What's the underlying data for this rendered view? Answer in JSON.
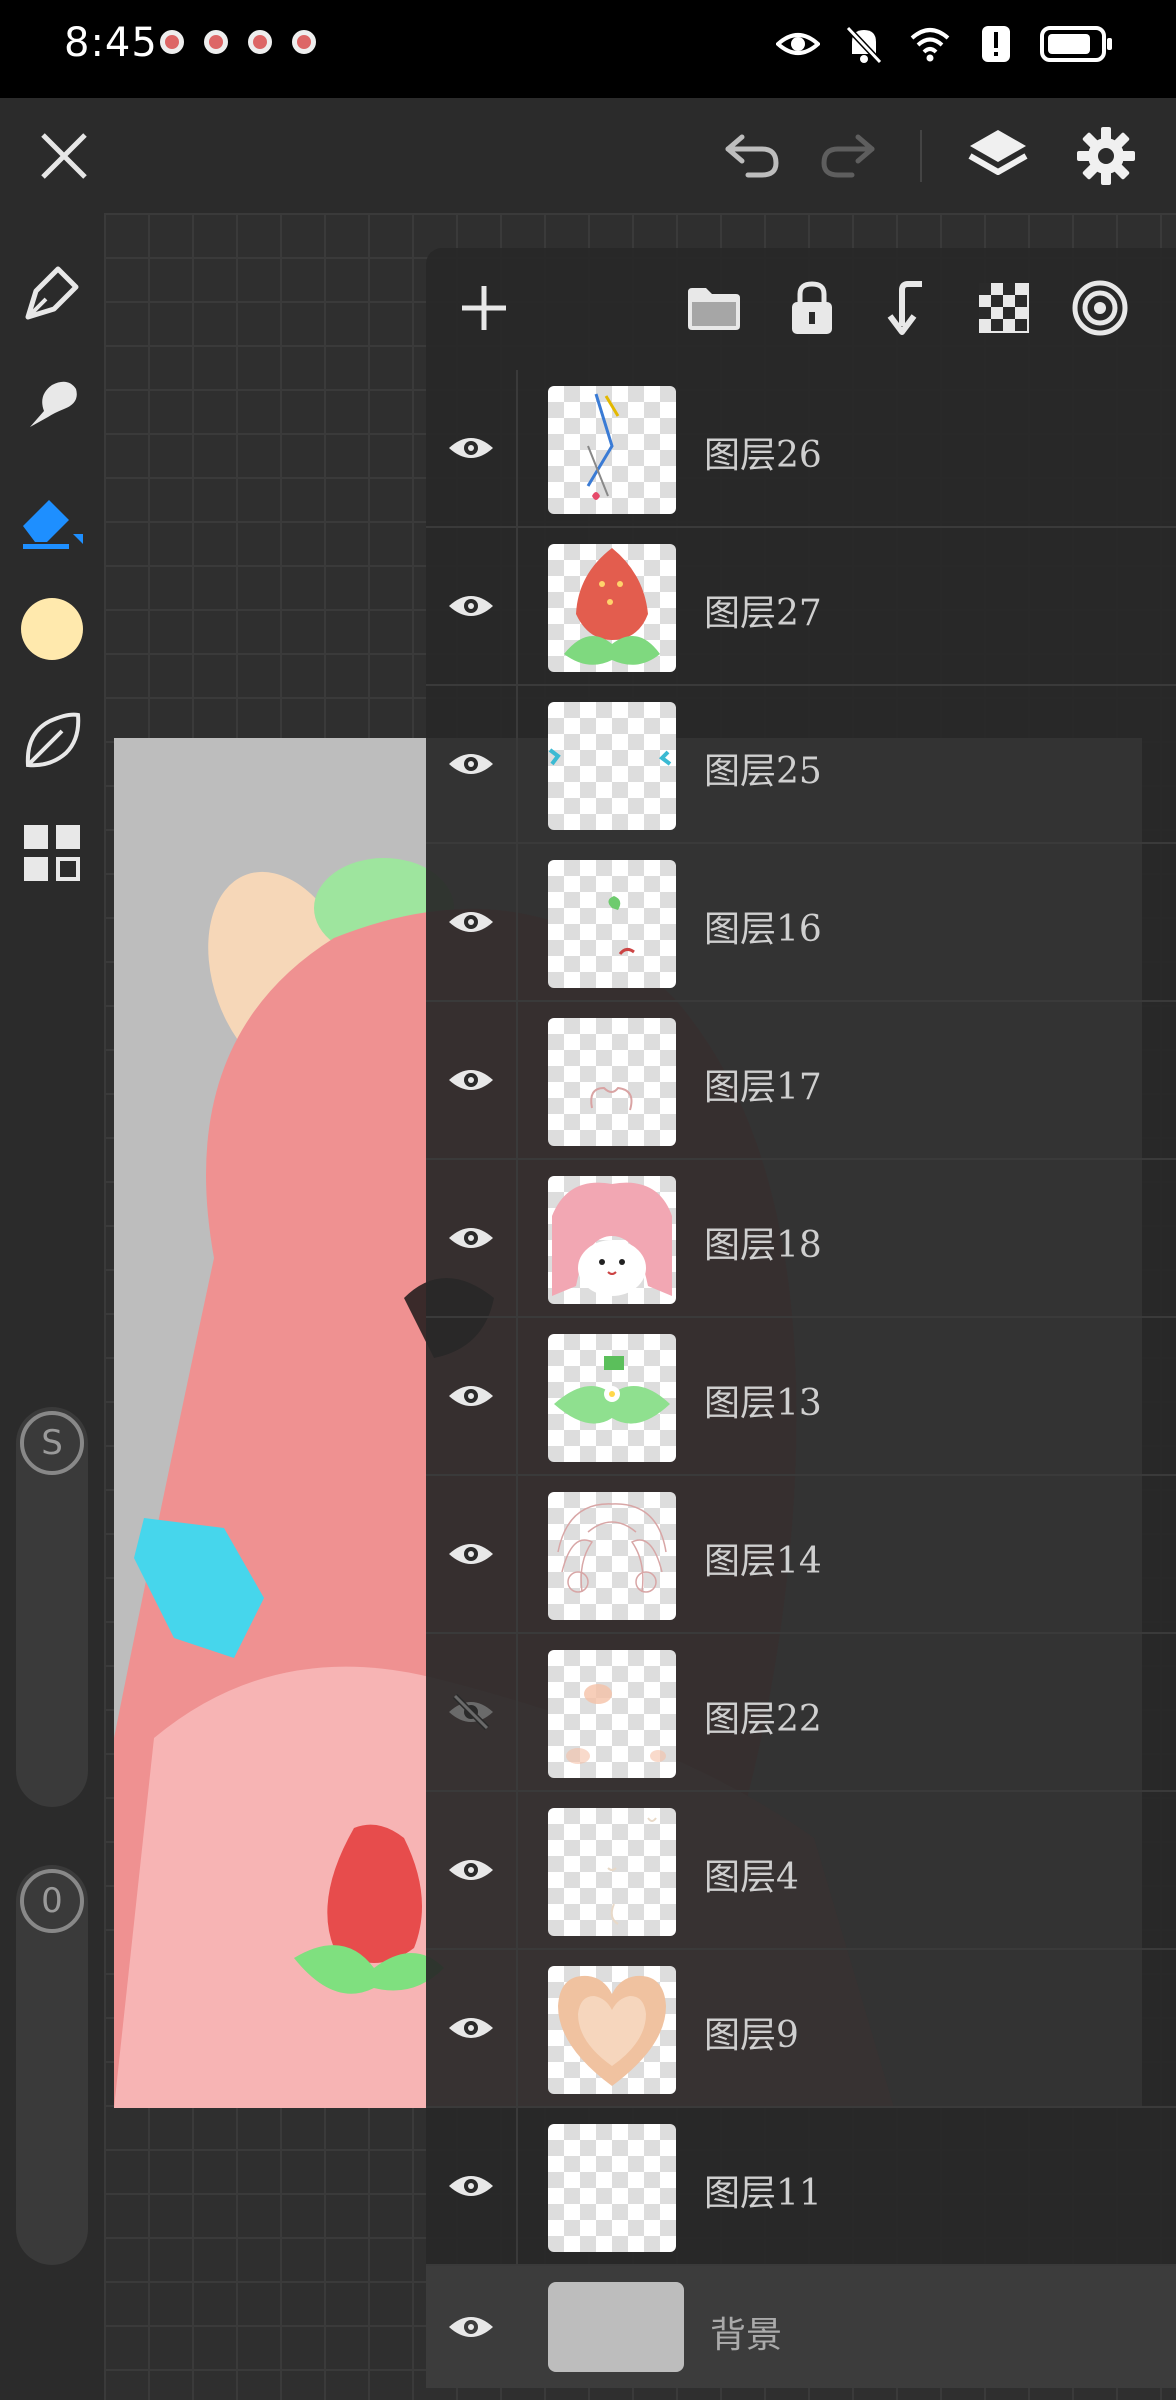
{
  "status_bar": {
    "time": "8:45"
  },
  "canvas": {
    "background_color": "#bdbdbd"
  },
  "layers": [
    {
      "name": "图层26",
      "visible": true,
      "thumb": "drop"
    },
    {
      "name": "图层27",
      "visible": true,
      "thumb": "strawberry"
    },
    {
      "name": "图层25",
      "visible": true,
      "thumb": "blue-edges"
    },
    {
      "name": "图层16",
      "visible": true,
      "thumb": "sprig"
    },
    {
      "name": "图层17",
      "visible": true,
      "thumb": "lines"
    },
    {
      "name": "图层18",
      "visible": true,
      "thumb": "face"
    },
    {
      "name": "图层13",
      "visible": true,
      "thumb": "leaves"
    },
    {
      "name": "图层14",
      "visible": true,
      "thumb": "sketch"
    },
    {
      "name": "图层22",
      "visible": false,
      "thumb": "blush"
    },
    {
      "name": "图层4",
      "visible": true,
      "thumb": "faint"
    },
    {
      "name": "图层9",
      "visible": true,
      "thumb": "heart"
    },
    {
      "name": "图层11",
      "visible": true,
      "thumb": "empty"
    }
  ],
  "background_layer": {
    "name": "背景",
    "visible": true
  },
  "sliders": {
    "size_label": "S",
    "opacity_label": "0"
  }
}
